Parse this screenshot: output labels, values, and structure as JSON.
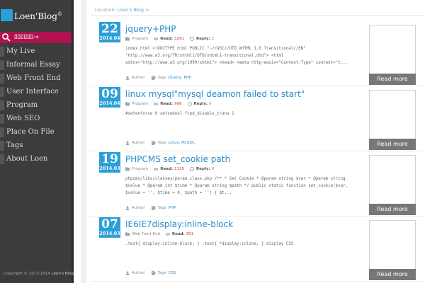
{
  "sidebar": {
    "logo": {
      "name": "Loen'Blog",
      "mark": "©"
    },
    "search": {
      "label": "ﾛﾛﾛﾛﾛﾛ→",
      "icon": "search-icon"
    },
    "nav": [
      {
        "label": "My Live"
      },
      {
        "label": "Informal Essay"
      },
      {
        "label": "Web Front End"
      },
      {
        "label": "User Interface"
      },
      {
        "label": "Program"
      },
      {
        "label": "Web SEO"
      },
      {
        "label": "Place On File"
      },
      {
        "label": "Tags"
      },
      {
        "label": "About Loen"
      }
    ],
    "copyright": {
      "prefix": "Copyright © 2013-2014",
      "site": "Loen's Blog"
    }
  },
  "location": {
    "label": "Location:",
    "link": "Loen's Blog >"
  },
  "read_label": "Read:",
  "reply_label": "Reply:",
  "author_label": "Author",
  "tags_label": "Tags",
  "readmore_label": "Read more",
  "colors": {
    "accent": "#2a9fd8",
    "search": "#b0124f",
    "read_count": "#d9341c"
  },
  "posts": [
    {
      "day": "22",
      "ym": "2014.04",
      "title": "jquery+PHP",
      "category": "Program",
      "read": "3291",
      "reply": "2",
      "excerpt": "index.html <!DOCTYPE html PUBLIC \"-//W3C//DTD XHTML 1.0 Transitional//EN\" \"http://www.w3.org/TR/xhtml1/DTD/xhtml1-transitional.dtd\"> <html xmlns=\"http://www.w3.org/1999/xhtml\"> <head> <meta http-equiv=\"Content-Type\" content=\"t...",
      "tags": "jQuery, PHP"
    },
    {
      "day": "09",
      "ym": "2014.04",
      "title": "linux mysql\"mysql deamon failed to start\"",
      "category": "Program",
      "read": "906",
      "reply": "0",
      "excerpt": "#setenforce 0      setsebool ftpd_disable_trans 1",
      "tags": "Linux, MySQL"
    },
    {
      "day": "19",
      "ym": "2014.03",
      "title": "PHPCMS set_cookie path",
      "category": "Program",
      "read": "1120",
      "reply": "0",
      "excerpt": "phpcms/libs/classes/param.class.php /** * Set Cookie * @param string $var * @param string $value * @param int $time * @param string $path */ public static function set_cookie($var, $value = '', $time = 0, $path = '') { $t...",
      "tags": "PHP"
    },
    {
      "day": "07",
      "ym": "2014.03",
      "title": "IE6IE7display:inline-block",
      "category": "Web Front End",
      "read": "951",
      "reply": "",
      "excerpt": ".test{ display:inline-block; } .test{ *display:inline; }        display CSS",
      "tags": "CSS"
    }
  ]
}
